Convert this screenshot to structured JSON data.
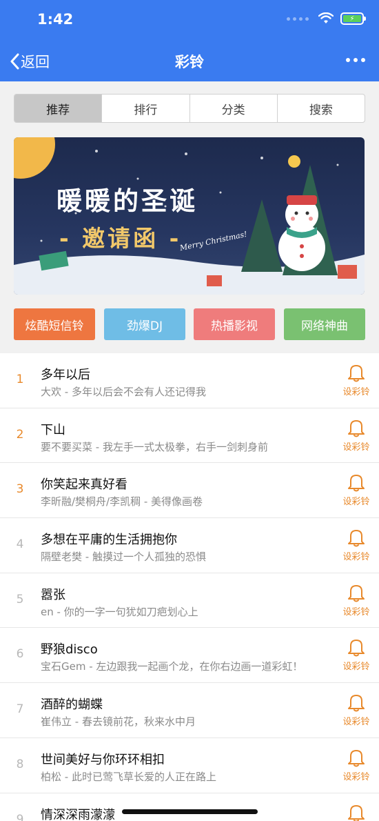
{
  "status": {
    "time": "1:42"
  },
  "nav": {
    "back_label": "返回",
    "title": "彩铃"
  },
  "tabs": [
    {
      "label": "推荐",
      "active": true
    },
    {
      "label": "排行",
      "active": false
    },
    {
      "label": "分类",
      "active": false
    },
    {
      "label": "搜索",
      "active": false
    }
  ],
  "banner": {
    "title": "暖暖的圣诞",
    "subtitle": "- 邀请函 -",
    "script_text": "Merry Christmas!"
  },
  "categories": [
    {
      "label": "炫酷短信铃",
      "color": "#ee7640"
    },
    {
      "label": "劲爆DJ",
      "color": "#6fbde6"
    },
    {
      "label": "热播影视",
      "color": "#ef7c7c"
    },
    {
      "label": "网络神曲",
      "color": "#7ac171"
    }
  ],
  "colors": {
    "header_bg": "#3a7bf0",
    "top_rank": "#e8892b",
    "rank": "#b8b8b8",
    "accent": "#e8892b"
  },
  "songs": [
    {
      "rank": "1",
      "title": "多年以后",
      "desc": "大欢 - 多年以后会不会有人还记得我",
      "action": "设彩铃"
    },
    {
      "rank": "2",
      "title": "下山",
      "desc": "要不要买菜 - 我左手一式太极拳，右手一剑刺身前",
      "action": "设彩铃"
    },
    {
      "rank": "3",
      "title": "你笑起来真好看",
      "desc": "李昕融/樊桐舟/李凯稠 - 美得像画卷",
      "action": "设彩铃"
    },
    {
      "rank": "4",
      "title": "多想在平庸的生活拥抱你",
      "desc": "隔壁老樊 - 触摸过一个人孤独的恐惧",
      "action": "设彩铃"
    },
    {
      "rank": "5",
      "title": "嚣张",
      "desc": "en - 你的一字一句犹如刀疤划心上",
      "action": "设彩铃"
    },
    {
      "rank": "6",
      "title": "野狼disco",
      "desc": "宝石Gem - 左边跟我一起画个龙，在你右边画一道彩虹！",
      "action": "设彩铃"
    },
    {
      "rank": "7",
      "title": "酒醉的蝴蝶",
      "desc": "崔伟立 - 春去镜前花，秋来水中月",
      "action": "设彩铃"
    },
    {
      "rank": "8",
      "title": "世间美好与你环环相扣",
      "desc": "柏松 - 此时已莺飞草长爱的人正在路上",
      "action": "设彩铃"
    },
    {
      "rank": "9",
      "title": "情深深雨濛濛",
      "desc": "",
      "action": "设彩铃"
    }
  ]
}
